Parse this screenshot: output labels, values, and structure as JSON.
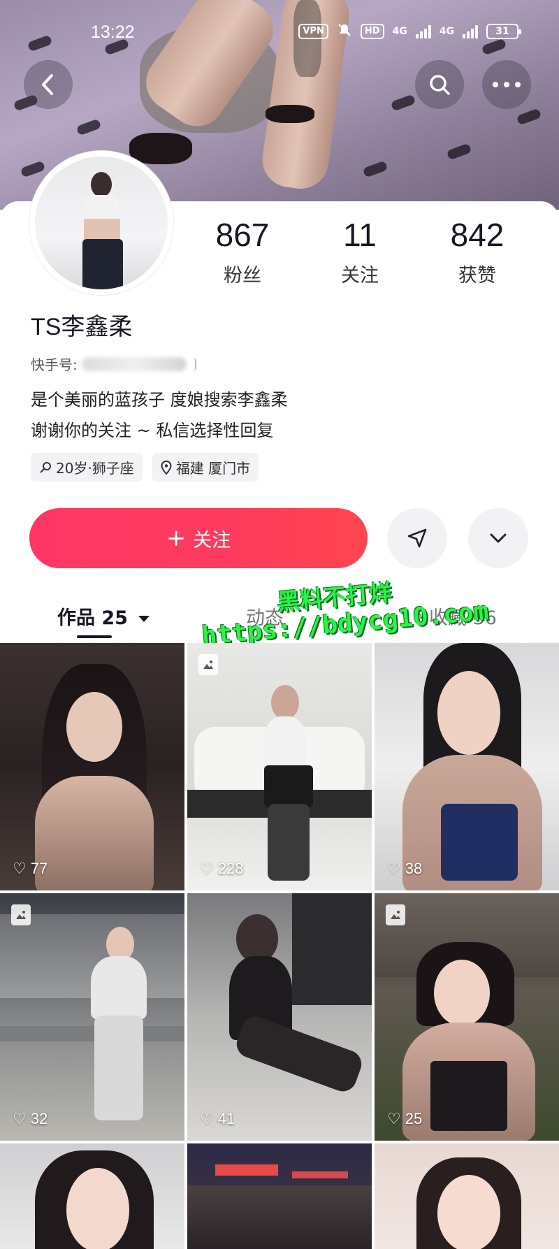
{
  "status_bar": {
    "time": "13:22",
    "vpn": "VPN",
    "hd": "HD",
    "net1": "4G",
    "net2": "4G",
    "battery": "31"
  },
  "profile": {
    "followers_count": "867",
    "followers_label": "粉丝",
    "following_count": "11",
    "following_label": "关注",
    "likes_count": "842",
    "likes_label": "获赞",
    "username": "TS李鑫柔",
    "id_label": "快手号:",
    "bio_line1": "是个美丽的蓝孩子 度娘搜索李鑫柔",
    "bio_line2": "谢谢你的关注 ~ 私信选择性回复",
    "tag_age": "20岁·狮子座",
    "tag_location": "福建 厦门市"
  },
  "actions": {
    "follow_label": "关注",
    "follow_plus": "+"
  },
  "tabs": {
    "works": "作品 25",
    "moments": "动态",
    "favorites": "收藏 36"
  },
  "watermark": {
    "line1": "黑料不打烊",
    "line2": "https://bdycg10.com"
  },
  "posts": [
    {
      "likes": "77"
    },
    {
      "likes": "228"
    },
    {
      "likes": "38"
    },
    {
      "likes": "32"
    },
    {
      "likes": "41"
    },
    {
      "likes": "25"
    }
  ],
  "colors": {
    "accent": "#fe3666",
    "text_primary": "#161823",
    "watermark": "#2bf24a"
  }
}
